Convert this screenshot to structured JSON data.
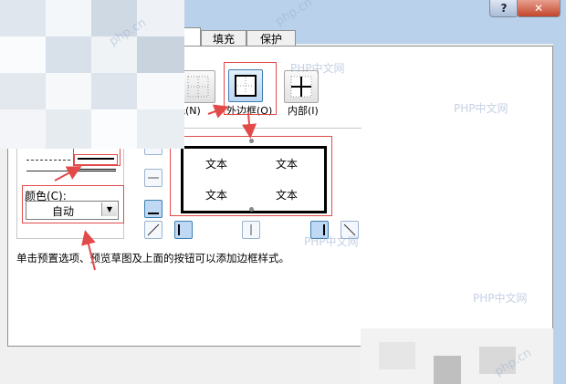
{
  "window": {
    "help_glyph": "?",
    "close_glyph": "✕"
  },
  "tabs": [
    {
      "label": ""
    },
    {
      "label": "填充"
    },
    {
      "label": "保护"
    }
  ],
  "presets": [
    {
      "label": "无(N)",
      "visible_label": "无(N)"
    },
    {
      "label": "外边框(O)"
    },
    {
      "label": "内部(I)"
    }
  ],
  "preview": {
    "cells": [
      "文本",
      "文本",
      "文本",
      "文本"
    ]
  },
  "color": {
    "label": "颜色(C):",
    "value": "自动"
  },
  "hint": "单击预置选项、预览草图及上面的按钮可以添加边框样式。",
  "watermark": "PHP中文网",
  "watermark_url": "php.cn",
  "colors": {
    "highlight": "#e24a4a",
    "titlebar": "#b9d1ea"
  }
}
